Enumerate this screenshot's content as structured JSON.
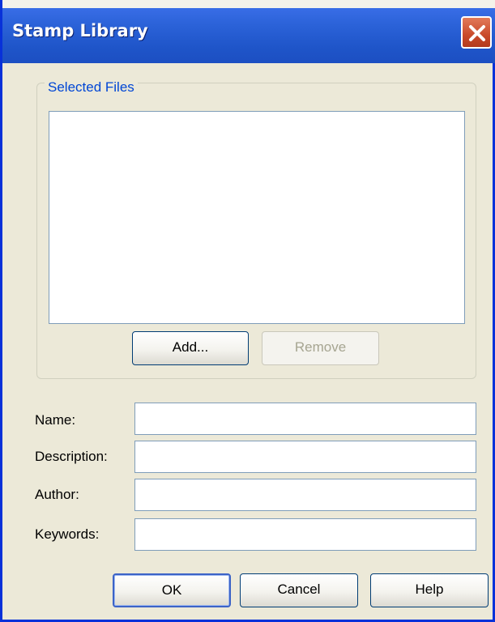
{
  "window": {
    "title": "Stamp Library",
    "close_icon": "close-icon"
  },
  "selected_files": {
    "legend": "Selected Files",
    "items": [],
    "add_label": "Add...",
    "remove_label": "Remove",
    "remove_enabled": false
  },
  "fields": {
    "name_label": "Name:",
    "name_value": "",
    "description_label": "Description:",
    "description_value": "",
    "author_label": "Author:",
    "author_value": "",
    "keywords_label": "Keywords:",
    "keywords_value": ""
  },
  "buttons": {
    "ok_label": "OK",
    "cancel_label": "Cancel",
    "help_label": "Help"
  },
  "colors": {
    "titlebar": "#2b62d8",
    "close": "#c94a2a",
    "dialog_bg": "#ece9d8",
    "legend_text": "#0046d5",
    "field_border": "#7f9db9"
  }
}
